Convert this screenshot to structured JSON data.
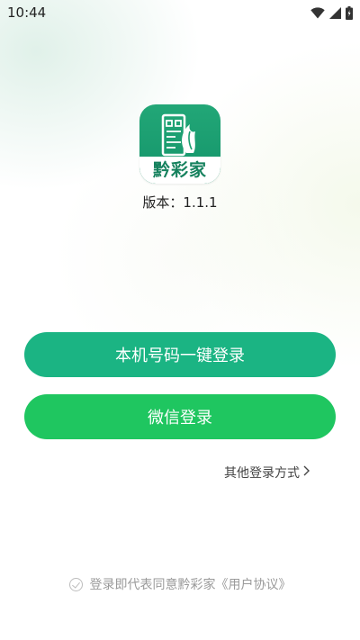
{
  "status_bar": {
    "time": "10:44",
    "icons": [
      "wifi-icon",
      "signal-icon",
      "battery-icon"
    ]
  },
  "app": {
    "logo_text": "黔彩家",
    "version_label": "版本：1.1.1",
    "brand_color": "#1bb483"
  },
  "buttons": {
    "one_click_login": "本机号码一键登录",
    "wechat_login": "微信登录",
    "wechat_color": "#1fc660"
  },
  "other_login": {
    "label": "其他登录方式",
    "icon": "chevron-right-icon"
  },
  "agreement": {
    "prefix": "登录即代表同意黔彩家",
    "link": "《用户协议》",
    "checked": false
  }
}
